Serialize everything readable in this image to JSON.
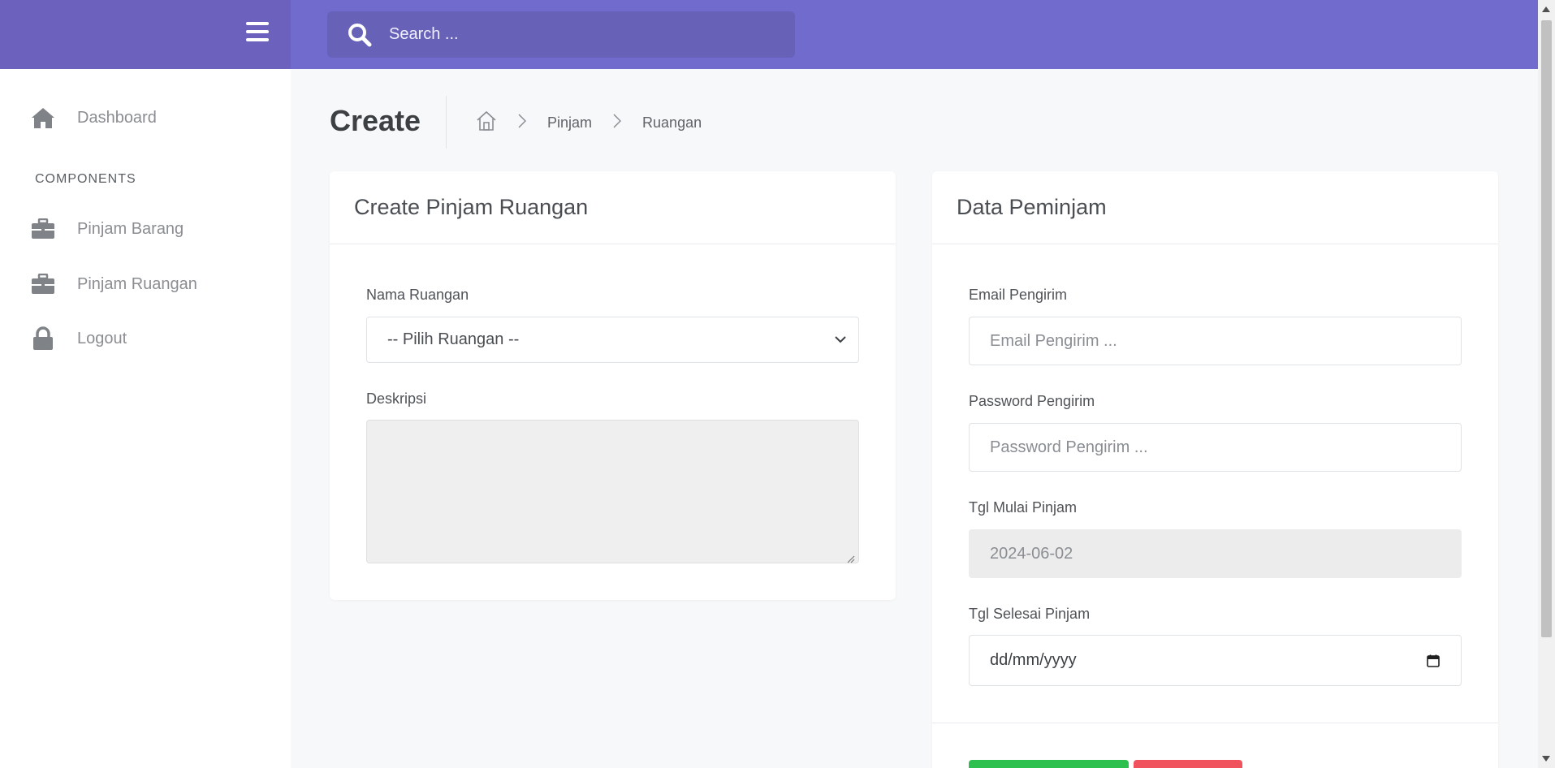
{
  "header": {
    "search_placeholder": "Search ..."
  },
  "sidebar": {
    "items": [
      {
        "label": "Dashboard",
        "icon": "home-icon"
      },
      {
        "label": "Pinjam Barang",
        "icon": "briefcase-icon"
      },
      {
        "label": "Pinjam Ruangan",
        "icon": "briefcase-icon"
      },
      {
        "label": "Logout",
        "icon": "lock-icon"
      }
    ],
    "section_label": "COMPONENTS"
  },
  "page": {
    "title": "Create",
    "breadcrumb": [
      "Pinjam",
      "Ruangan"
    ]
  },
  "form_card": {
    "title": "Create Pinjam Ruangan",
    "room_label": "Nama Ruangan",
    "room_selected": "-- Pilih Ruangan --",
    "description_label": "Deskripsi",
    "description_value": ""
  },
  "borrower_card": {
    "title": "Data Peminjam",
    "email_label": "Email Pengirim",
    "email_placeholder": "Email Pengirim ...",
    "password_label": "Password Pengirim",
    "password_placeholder": "Password Pengirim ...",
    "start_label": "Tgl Mulai Pinjam",
    "start_value": "2024-06-02",
    "end_label": "Tgl Selesai Pinjam",
    "end_placeholder": "dd/mm/yyyy"
  },
  "colors": {
    "topbar": "#706bcc",
    "brand": "#6c62bd",
    "save_button": "#2ec04f",
    "cancel_button": "#f0525e"
  }
}
